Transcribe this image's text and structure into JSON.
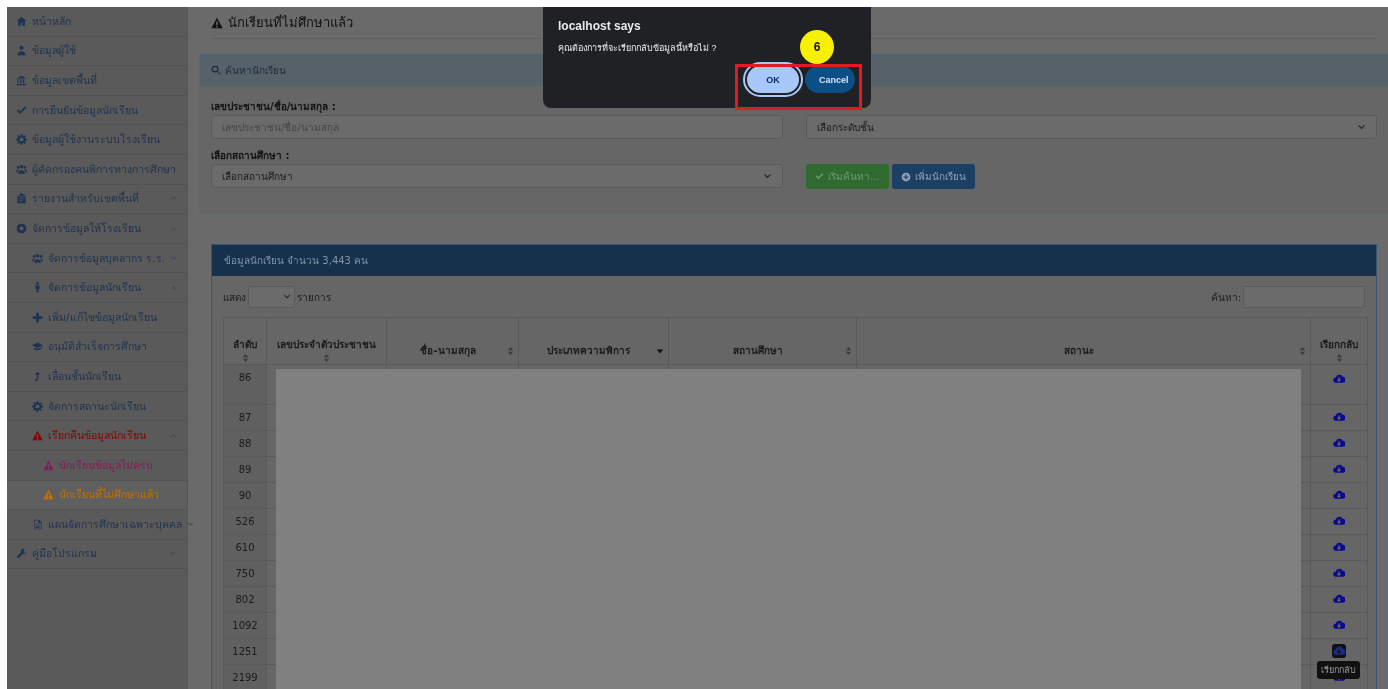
{
  "sidebar": {
    "items": [
      {
        "label": "หน้าหลัก"
      },
      {
        "label": "ข้อมูลผู้ใช้"
      },
      {
        "label": "ข้อมูลเขตพื้นที่"
      },
      {
        "label": "การยืนยันข้อมูลนักเรียน"
      },
      {
        "label": "ข้อมูลผู้ใช้งานระบบโรงเรียน"
      },
      {
        "label": "ผู้คัดกรองคนพิการทางการศึกษา"
      },
      {
        "label": "รายงานสำหรับเขตพื้นที่",
        "expanded": false
      },
      {
        "label": "จัดการข้อมูลให้โรงเรียน",
        "expanded": true,
        "children": [
          {
            "label": "จัดการข้อมูลบุคลากร ร.ร.",
            "expanded": false
          },
          {
            "label": "จัดการข้อมูลนักเรียน",
            "expanded": true,
            "children": [
              {
                "label": "เพิ่ม/แก้ไขข้อมูลนักเรียน"
              },
              {
                "label": "อนุมัติสำเร็จการศึกษา"
              },
              {
                "label": "เลื่อนชั้นนักเรียน"
              },
              {
                "label": "จัดการสถานะนักเรียน"
              },
              {
                "label": "เรียกคืนข้อมูลนักเรียน",
                "color": "#8b0000",
                "expanded": true,
                "children": [
                  {
                    "label": "นักเรียนข้อมูลไม่ครบ",
                    "color": "#8b1a5a",
                    "selected": false
                  },
                  {
                    "label": "นักเรียนที่ไม่ศึกษาแล้ว",
                    "color": "#c87000",
                    "selected": true
                  }
                ]
              }
            ]
          },
          {
            "label": "แผนจัดการศึกษาเฉพาะบุคคล",
            "expanded": false
          }
        ]
      },
      {
        "label": "คู่มือโปรแกรม",
        "expanded": false
      }
    ]
  },
  "page_title": "นักเรียนที่ไม่ศึกษาแล้ว",
  "search_panel": {
    "title": "ค้นหานักเรียน",
    "id_label": "เลขประชาชน/ชื่อ/นามสกุล :",
    "id_placeholder": "เลขประชาชน/ชื่อ/นามสกุล",
    "grade_select": "เลือกระดับชั้น",
    "school_label": "เลือกสถานศึกษา :",
    "school_select": "เลือกสถานศึกษา",
    "search_button": "เริ่มค้นหา...",
    "add_button": "เพิ่มนักเรียน"
  },
  "table_panel": {
    "title": "ข้อมูลนักเรียน จำนวน 3,443 คน",
    "show_label": "แสดง",
    "entries_label": "รายการ",
    "search_label": "ค้นหา:",
    "columns": [
      {
        "label": "ลำดับ",
        "sorted": false
      },
      {
        "label": "เลขประจำตัวประชาชน",
        "sorted": false
      },
      {
        "label": "ชื่อ-นามสกุล",
        "sorted": false
      },
      {
        "label": "ประเภทความพิการ",
        "sorted": true
      },
      {
        "label": "สถานศึกษา",
        "sorted": false
      },
      {
        "label": "สถานะ",
        "sorted": false
      },
      {
        "label": "เรียกกลับ",
        "sorted": false
      }
    ],
    "rows": [
      {
        "number": "86",
        "hovered": false
      },
      {
        "number": "87",
        "hovered": false
      },
      {
        "number": "88",
        "hovered": false
      },
      {
        "number": "89",
        "hovered": false
      },
      {
        "number": "90",
        "hovered": false
      },
      {
        "number": "526",
        "hovered": false
      },
      {
        "number": "610",
        "hovered": false
      },
      {
        "number": "750",
        "hovered": false
      },
      {
        "number": "802",
        "hovered": false
      },
      {
        "number": "1092",
        "hovered": false
      },
      {
        "number": "1251",
        "hovered": true
      },
      {
        "number": "2199",
        "hovered": false
      }
    ],
    "tooltip": "เรียกกลับ"
  },
  "dialog": {
    "title": "localhost says",
    "message": "คุณต้องการที่จะเรียกกลับข้อมูลนี้หรือไม่ ?",
    "buttons": [
      {
        "label": "OK",
        "kind": "ok",
        "focused": true
      },
      {
        "label": "Cancel",
        "kind": "cancel",
        "focused": false
      }
    ]
  },
  "annotation": {
    "step": "6"
  }
}
